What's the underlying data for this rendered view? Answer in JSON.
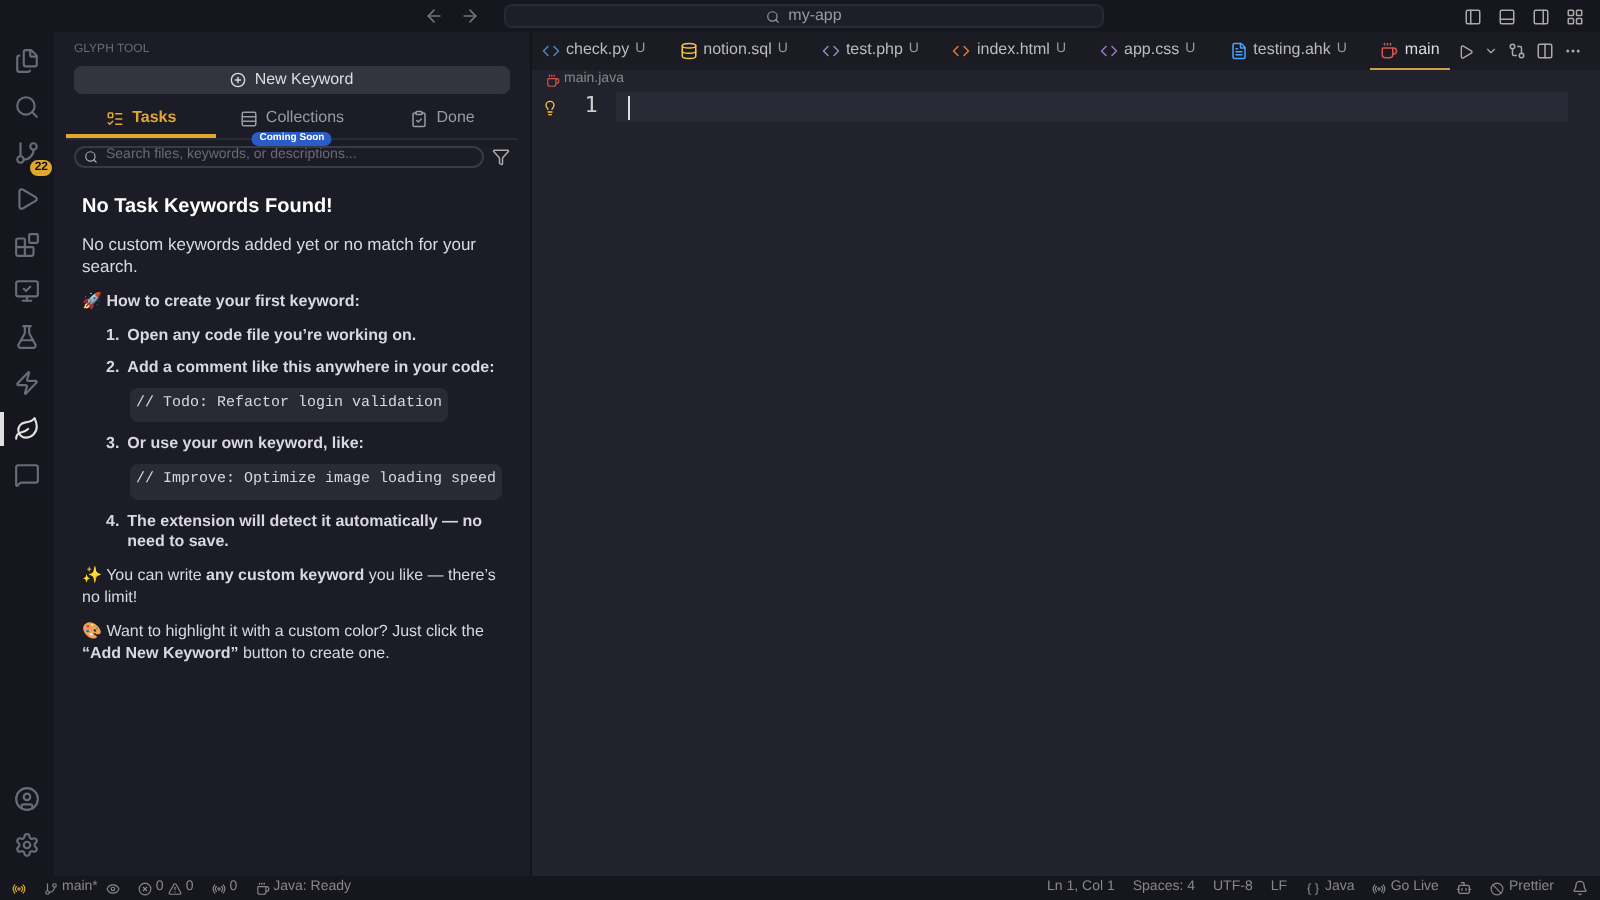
{
  "title_bar": {
    "search": "my-app"
  },
  "activity_bar": {
    "items": [
      {
        "kind": "files",
        "selected": false
      },
      {
        "kind": "search",
        "selected": false
      },
      {
        "kind": "source-control",
        "selected": false,
        "badge": "22"
      },
      {
        "kind": "run",
        "selected": false
      },
      {
        "kind": "extensions",
        "selected": false
      },
      {
        "kind": "remote",
        "selected": false
      },
      {
        "kind": "testing",
        "selected": false
      },
      {
        "kind": "lightning",
        "selected": false
      },
      {
        "kind": "glyph",
        "selected": true
      },
      {
        "kind": "chat",
        "selected": false
      }
    ],
    "bottom": [
      {
        "kind": "account"
      },
      {
        "kind": "settings"
      }
    ]
  },
  "sidebar": {
    "header": "GLYPH TOOL",
    "new_button": "New Keyword",
    "tabs": [
      {
        "kind": "tasks",
        "label": "Tasks",
        "selected": true
      },
      {
        "kind": "collections",
        "label": "Collections",
        "selected": false,
        "badge": "Coming Soon"
      },
      {
        "kind": "done",
        "label": "Done",
        "selected": false
      }
    ],
    "search": {
      "placeholder": "Search files, keywords, or descriptions..."
    },
    "empty": {
      "title": "No Task Keywords Found!",
      "text": "No custom keywords added yet or no match for your search.",
      "howto": "🚀 How to create your first keyword:",
      "steps": [
        {
          "number": "1.",
          "text": "Open any code file you’re working on."
        },
        {
          "number": "2.",
          "text": "Add a comment like this anywhere in your code:",
          "code": "// Todo: Refactor login validation"
        },
        {
          "number": "3.",
          "text": "Or use your own keyword, like:",
          "code": "// Improve: Optimize image loading speed"
        },
        {
          "number": "4.",
          "text": "The extension will detect it automatically — no need to save."
        }
      ],
      "tips": [
        "✨ You can write **any custom keyword** you like — there’s no limit!",
        "🎨 Want to highlight it with a custom color? Just click the **“Add New Keyword”** button to create one."
      ]
    }
  },
  "editor": {
    "tabs": [
      {
        "kind": "python",
        "label": "check.py",
        "status": "U",
        "selected": false
      },
      {
        "kind": "database",
        "label": "notion.sql",
        "status": "U",
        "selected": false
      },
      {
        "kind": "php",
        "label": "test.php",
        "status": "U",
        "selected": false
      },
      {
        "kind": "html",
        "label": "index.html",
        "status": "U",
        "selected": false
      },
      {
        "kind": "css",
        "label": "app.css",
        "status": "U",
        "selected": false
      },
      {
        "kind": "file",
        "label": "testing.ahk",
        "status": "U",
        "selected": false
      },
      {
        "kind": "java",
        "label": "main",
        "selected": true
      }
    ],
    "breadcrumb": "main.java",
    "line_numbers": [
      "1"
    ]
  },
  "status_bar": {
    "branch": "main*",
    "errors": "0",
    "warnings": "0",
    "ports": "0",
    "java_status": "Java: Ready",
    "right": [
      {
        "kind": "text",
        "text": "Ln 1, Col 1"
      },
      {
        "kind": "text",
        "text": "Spaces: 4"
      },
      {
        "kind": "text",
        "text": "UTF-8"
      },
      {
        "kind": "text",
        "text": "LF"
      },
      {
        "kind": "language",
        "text": "Java"
      },
      {
        "kind": "live",
        "text": "Go Live"
      },
      {
        "kind": "copilot"
      },
      {
        "kind": "prettier",
        "text": "Prettier"
      },
      {
        "kind": "bell"
      }
    ]
  }
}
